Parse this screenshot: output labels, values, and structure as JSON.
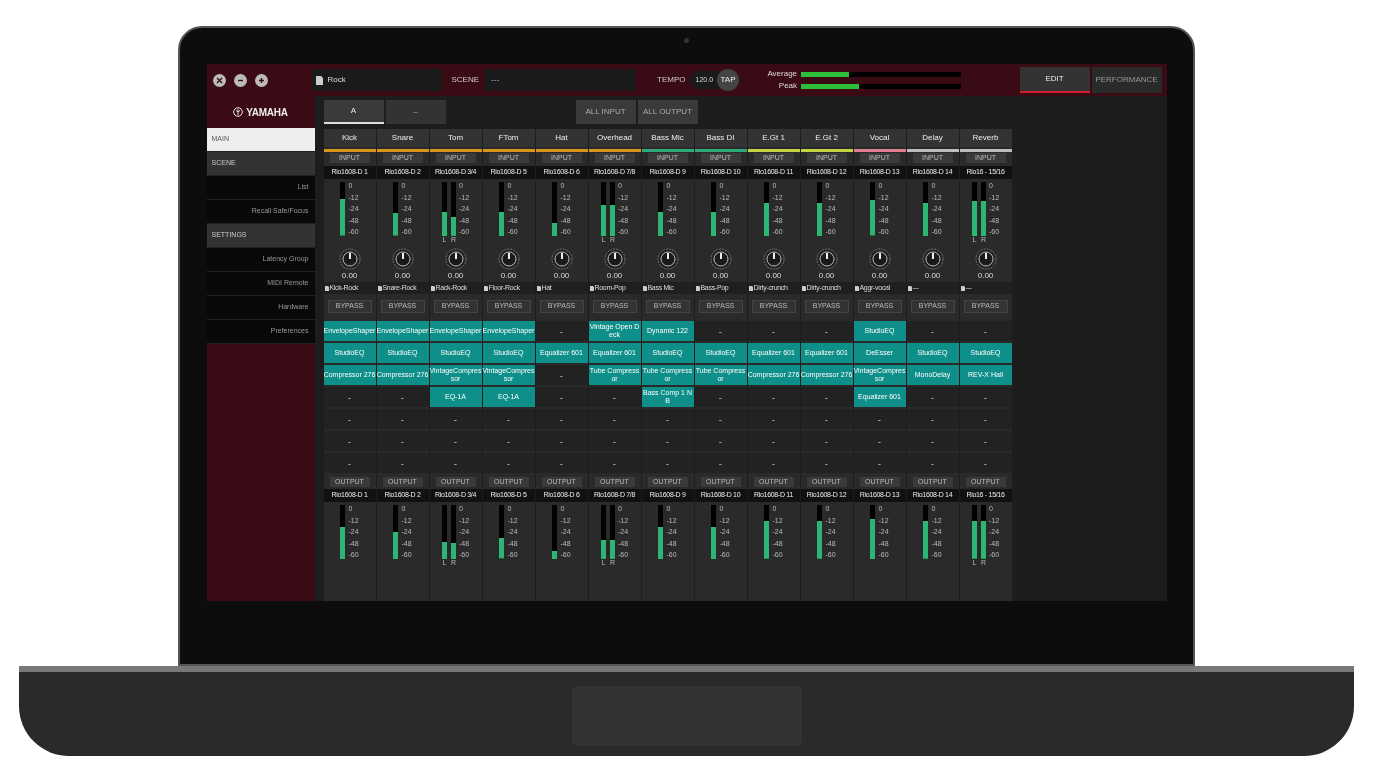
{
  "window": {
    "file_name": "Rock",
    "scene_label": "SCENE",
    "scene_value": "---",
    "tempo_label": "TEMPO",
    "tempo_value": "120.0",
    "tap_label": "TAP",
    "level_meters": [
      {
        "label": "Average",
        "level": 0.3
      },
      {
        "label": "Peak",
        "level": 0.36
      }
    ],
    "mode_tabs": [
      {
        "label": "EDIT",
        "selected": true
      },
      {
        "label": "PERFORMANCE",
        "selected": false
      }
    ]
  },
  "sidebar": {
    "logo": "YAMAHA",
    "items": [
      {
        "kind": "section",
        "label": "MAIN",
        "selected": true
      },
      {
        "kind": "section",
        "label": "SCENE",
        "selected": false
      },
      {
        "kind": "sub",
        "label": "List",
        "selected": false
      },
      {
        "kind": "sub",
        "label": "Recall Safe/Focus",
        "selected": false
      },
      {
        "kind": "section",
        "label": "SETTINGS",
        "selected": false
      },
      {
        "kind": "sub",
        "label": "Latency Group",
        "selected": false
      },
      {
        "kind": "sub",
        "label": "MIDI Remote",
        "selected": false
      },
      {
        "kind": "sub",
        "label": "Hardware",
        "selected": false
      },
      {
        "kind": "sub",
        "label": "Preferences",
        "selected": false
      }
    ]
  },
  "rack_tabs": [
    {
      "label": "A",
      "selected": true
    },
    {
      "label": "–",
      "selected": false
    }
  ],
  "rack_buttons": [
    "ALL INPUT",
    "ALL OUTPUT"
  ],
  "channels": [
    {
      "name": "Kick",
      "color": "#d8971c",
      "input_label": "INPUT",
      "patch": "Rio1608-D 1",
      "meters": [
        {
          "level": 0.68
        }
      ],
      "scale": [
        "0",
        "-12",
        "-24",
        "-48",
        "-60"
      ],
      "knob_value": "0.00",
      "preset": "Kick-Rock",
      "bypass_label": "BYPASS",
      "inserts": [
        {
          "kind": "plugin",
          "name": "EnvelopeShaper"
        },
        {
          "kind": "plugin",
          "name": "StudioEQ"
        },
        {
          "kind": "plugin",
          "name": "Compressor 276"
        },
        {
          "kind": "empty",
          "name": "-"
        },
        {
          "kind": "empty",
          "name": "-"
        },
        {
          "kind": "empty",
          "name": "-"
        },
        {
          "kind": "empty",
          "name": "-"
        }
      ],
      "output_label": "OUTPUT",
      "output_patch": "Rio1608-D 1",
      "output_meters": [
        {
          "level": 0.6
        }
      ],
      "output_scale": [
        "0",
        "-12",
        "-24",
        "-48",
        "-60"
      ]
    },
    {
      "name": "Snare",
      "color": "#d8971c",
      "input_label": "INPUT",
      "patch": "Rio1608-D 2",
      "meters": [
        {
          "level": 0.42
        }
      ],
      "scale": [
        "0",
        "-12",
        "-24",
        "-48",
        "-60"
      ],
      "knob_value": "0.00",
      "preset": "Snare-Rock",
      "bypass_label": "BYPASS",
      "inserts": [
        {
          "kind": "plugin",
          "name": "EnvelopeShaper"
        },
        {
          "kind": "plugin",
          "name": "StudioEQ"
        },
        {
          "kind": "plugin",
          "name": "Compressor 276"
        },
        {
          "kind": "empty",
          "name": "-"
        },
        {
          "kind": "empty",
          "name": "-"
        },
        {
          "kind": "empty",
          "name": "-"
        },
        {
          "kind": "empty",
          "name": "-"
        }
      ],
      "output_label": "OUTPUT",
      "output_patch": "Rio1608-D 2",
      "output_meters": [
        {
          "level": 0.5
        }
      ],
      "output_scale": [
        "0",
        "-12",
        "-24",
        "-48",
        "-60"
      ]
    },
    {
      "name": "Tom",
      "color": "#d8971c",
      "input_label": "INPUT",
      "patch": "Rio1608-D 3/4",
      "meters": [
        {
          "label": "L",
          "level": 0.45
        },
        {
          "label": "R",
          "level": 0.35
        }
      ],
      "scale": [
        "0",
        "-12",
        "-24",
        "-48",
        "-60"
      ],
      "knob_value": "0.00",
      "preset": "Rack-Rock",
      "bypass_label": "BYPASS",
      "inserts": [
        {
          "kind": "plugin",
          "name": "EnvelopeShaper"
        },
        {
          "kind": "plugin",
          "name": "StudioEQ"
        },
        {
          "kind": "plugin",
          "name": "VintageCompressor"
        },
        {
          "kind": "plugin",
          "name": "EQ-1A"
        },
        {
          "kind": "empty",
          "name": "-"
        },
        {
          "kind": "empty",
          "name": "-"
        },
        {
          "kind": "empty",
          "name": "-"
        }
      ],
      "output_label": "OUTPUT",
      "output_patch": "Rio1608-D 3/4",
      "output_meters": [
        {
          "label": "L",
          "level": 0.32
        },
        {
          "label": "R",
          "level": 0.3
        }
      ],
      "output_scale": [
        "0",
        "-12",
        "-24",
        "-48",
        "-60"
      ]
    },
    {
      "name": "FTom",
      "color": "#d8971c",
      "input_label": "INPUT",
      "patch": "Rio1608-D 5",
      "meters": [
        {
          "level": 0.45
        }
      ],
      "scale": [
        "0",
        "-12",
        "-24",
        "-48",
        "-60"
      ],
      "knob_value": "0.00",
      "preset": "Floor-Rock",
      "bypass_label": "BYPASS",
      "inserts": [
        {
          "kind": "plugin",
          "name": "EnvelopeShaper"
        },
        {
          "kind": "plugin",
          "name": "StudioEQ"
        },
        {
          "kind": "plugin",
          "name": "VintageCompressor"
        },
        {
          "kind": "plugin",
          "name": "EQ-1A"
        },
        {
          "kind": "empty",
          "name": "-"
        },
        {
          "kind": "empty",
          "name": "-"
        },
        {
          "kind": "empty",
          "name": "-"
        }
      ],
      "output_label": "OUTPUT",
      "output_patch": "Rio1608-D 5",
      "output_meters": [
        {
          "level": 0.38
        }
      ],
      "output_scale": [
        "0",
        "-12",
        "-24",
        "-48",
        "-60"
      ]
    },
    {
      "name": "Hat",
      "color": "#d8971c",
      "input_label": "INPUT",
      "patch": "Rio1608-D 6",
      "meters": [
        {
          "level": 0.25
        }
      ],
      "scale": [
        "0",
        "-12",
        "-24",
        "-48",
        "-60"
      ],
      "knob_value": "0.00",
      "preset": "Hat",
      "bypass_label": "BYPASS",
      "inserts": [
        {
          "kind": "empty",
          "name": "-"
        },
        {
          "kind": "plugin",
          "name": "Equalizer 601"
        },
        {
          "kind": "empty",
          "name": "-"
        },
        {
          "kind": "empty",
          "name": "-"
        },
        {
          "kind": "empty",
          "name": "-"
        },
        {
          "kind": "empty",
          "name": "-"
        },
        {
          "kind": "empty",
          "name": "-"
        }
      ],
      "output_label": "OUTPUT",
      "output_patch": "Rio1608-D 6",
      "output_meters": [
        {
          "level": 0.15
        }
      ],
      "output_scale": [
        "0",
        "-12",
        "-24",
        "-48",
        "-60"
      ]
    },
    {
      "name": "Overhead",
      "color": "#d8971c",
      "input_label": "INPUT",
      "patch": "Rio1608-D 7/8",
      "meters": [
        {
          "label": "L",
          "level": 0.58
        },
        {
          "label": "R",
          "level": 0.58
        }
      ],
      "scale": [
        "0",
        "-12",
        "-24",
        "-48",
        "-60"
      ],
      "knob_value": "0.00",
      "preset": "Room-Pop",
      "bypass_label": "BYPASS",
      "inserts": [
        {
          "kind": "plugin",
          "name": "Vintage Open Deck"
        },
        {
          "kind": "plugin",
          "name": "Equalizer 601"
        },
        {
          "kind": "plugin",
          "name": "Tube Compressor"
        },
        {
          "kind": "empty",
          "name": "-"
        },
        {
          "kind": "empty",
          "name": "-"
        },
        {
          "kind": "empty",
          "name": "-"
        },
        {
          "kind": "empty",
          "name": "-"
        }
      ],
      "output_label": "OUTPUT",
      "output_patch": "Rio1608-D 7/8",
      "output_meters": [
        {
          "label": "L",
          "level": 0.35
        },
        {
          "label": "R",
          "level": 0.35
        }
      ],
      "output_scale": [
        "0",
        "-12",
        "-24",
        "-48",
        "-60"
      ]
    },
    {
      "name": "Bass Mic",
      "color": "#2fa97a",
      "input_label": "INPUT",
      "patch": "Rio1608-D 9",
      "meters": [
        {
          "level": 0.45
        }
      ],
      "scale": [
        "0",
        "-12",
        "-24",
        "-48",
        "-60"
      ],
      "knob_value": "0.00",
      "preset": "Bass Mic",
      "bypass_label": "BYPASS",
      "inserts": [
        {
          "kind": "plugin",
          "name": "Dynamic 122"
        },
        {
          "kind": "plugin",
          "name": "StudioEQ"
        },
        {
          "kind": "plugin",
          "name": "Tube Compressor"
        },
        {
          "kind": "plugin",
          "name": "Bass Comp 1 NB"
        },
        {
          "kind": "empty",
          "name": "-"
        },
        {
          "kind": "empty",
          "name": "-"
        },
        {
          "kind": "empty",
          "name": "-"
        }
      ],
      "output_label": "OUTPUT",
      "output_patch": "Rio1608-D 9",
      "output_meters": [
        {
          "level": 0.6
        }
      ],
      "output_scale": [
        "0",
        "-12",
        "-24",
        "-48",
        "-60"
      ]
    },
    {
      "name": "Bass DI",
      "color": "#2fa97a",
      "input_label": "INPUT",
      "patch": "Rio1608-D 10",
      "meters": [
        {
          "level": 0.45
        }
      ],
      "scale": [
        "0",
        "-12",
        "-24",
        "-48",
        "-60"
      ],
      "knob_value": "0.00",
      "preset": "Bass-Pop",
      "bypass_label": "BYPASS",
      "inserts": [
        {
          "kind": "empty",
          "name": "-"
        },
        {
          "kind": "plugin",
          "name": "StudioEQ"
        },
        {
          "kind": "plugin",
          "name": "Tube Compressor"
        },
        {
          "kind": "empty",
          "name": "-"
        },
        {
          "kind": "empty",
          "name": "-"
        },
        {
          "kind": "empty",
          "name": "-"
        },
        {
          "kind": "empty",
          "name": "-"
        }
      ],
      "output_label": "OUTPUT",
      "output_patch": "Rio1608-D 10",
      "output_meters": [
        {
          "level": 0.6
        }
      ],
      "output_scale": [
        "0",
        "-12",
        "-24",
        "-48",
        "-60"
      ]
    },
    {
      "name": "E.Gt 1",
      "color": "#c3d443",
      "input_label": "INPUT",
      "patch": "Rio1608-D 11",
      "meters": [
        {
          "level": 0.62
        }
      ],
      "scale": [
        "0",
        "-12",
        "-24",
        "-48",
        "-60"
      ],
      "knob_value": "0.00",
      "preset": "Dirty-crunch",
      "bypass_label": "BYPASS",
      "inserts": [
        {
          "kind": "empty",
          "name": "-"
        },
        {
          "kind": "plugin",
          "name": "Equalizer 601"
        },
        {
          "kind": "plugin",
          "name": "Compressor 276"
        },
        {
          "kind": "empty",
          "name": "-"
        },
        {
          "kind": "empty",
          "name": "-"
        },
        {
          "kind": "empty",
          "name": "-"
        },
        {
          "kind": "empty",
          "name": "-"
        }
      ],
      "output_label": "OUTPUT",
      "output_patch": "Rio1608-D 11",
      "output_meters": [
        {
          "level": 0.7
        }
      ],
      "output_scale": [
        "0",
        "-12",
        "-24",
        "-48",
        "-60"
      ]
    },
    {
      "name": "E.Gt 2",
      "color": "#c3d443",
      "input_label": "INPUT",
      "patch": "Rio1608-D 12",
      "meters": [
        {
          "level": 0.62
        }
      ],
      "scale": [
        "0",
        "-12",
        "-24",
        "-48",
        "-60"
      ],
      "knob_value": "0.00",
      "preset": "Dirty-crunch",
      "bypass_label": "BYPASS",
      "inserts": [
        {
          "kind": "empty",
          "name": "-"
        },
        {
          "kind": "plugin",
          "name": "Equalizer 601"
        },
        {
          "kind": "plugin",
          "name": "Compressor 276"
        },
        {
          "kind": "empty",
          "name": "-"
        },
        {
          "kind": "empty",
          "name": "-"
        },
        {
          "kind": "empty",
          "name": "-"
        },
        {
          "kind": "empty",
          "name": "-"
        }
      ],
      "output_label": "OUTPUT",
      "output_patch": "Rio1608-D 12",
      "output_meters": [
        {
          "level": 0.7
        }
      ],
      "output_scale": [
        "0",
        "-12",
        "-24",
        "-48",
        "-60"
      ]
    },
    {
      "name": "Vocal",
      "color": "#e07d8e",
      "input_label": "INPUT",
      "patch": "Rio1608-D 13",
      "meters": [
        {
          "level": 0.66
        }
      ],
      "scale": [
        "0",
        "-12",
        "-24",
        "-48",
        "-60"
      ],
      "knob_value": "0.00",
      "preset": "Aggr-vocal",
      "bypass_label": "BYPASS",
      "inserts": [
        {
          "kind": "plugin",
          "name": "StudioEQ"
        },
        {
          "kind": "plugin",
          "name": "DeEsser"
        },
        {
          "kind": "plugin",
          "name": "VintageCompressor"
        },
        {
          "kind": "plugin",
          "name": "Equalizer 601"
        },
        {
          "kind": "empty",
          "name": "-"
        },
        {
          "kind": "empty",
          "name": "-"
        },
        {
          "kind": "empty",
          "name": "-"
        }
      ],
      "output_label": "OUTPUT",
      "output_patch": "Rio1608-D 13",
      "output_meters": [
        {
          "level": 0.75
        }
      ],
      "output_scale": [
        "0",
        "-12",
        "-24",
        "-48",
        "-60"
      ]
    },
    {
      "name": "Delay",
      "color": "#bdbdbd",
      "input_label": "INPUT",
      "patch": "Rio1608-D 14",
      "meters": [
        {
          "level": 0.62
        }
      ],
      "scale": [
        "0",
        "-12",
        "-24",
        "-48",
        "-60"
      ],
      "knob_value": "0.00",
      "preset": "---",
      "bypass_label": "BYPASS",
      "inserts": [
        {
          "kind": "empty",
          "name": "-"
        },
        {
          "kind": "plugin",
          "name": "StudioEQ"
        },
        {
          "kind": "plugin",
          "name": "MonoDelay"
        },
        {
          "kind": "empty",
          "name": "-"
        },
        {
          "kind": "empty",
          "name": "-"
        },
        {
          "kind": "empty",
          "name": "-"
        },
        {
          "kind": "empty",
          "name": "-"
        }
      ],
      "output_label": "OUTPUT",
      "output_patch": "Rio1608-D 14",
      "output_meters": [
        {
          "level": 0.7
        }
      ],
      "output_scale": [
        "0",
        "-12",
        "-24",
        "-48",
        "-60"
      ]
    },
    {
      "name": "Reverb",
      "color": "#bdbdbd",
      "input_label": "INPUT",
      "patch": "Rio16 - 15/16",
      "meters": [
        {
          "label": "L",
          "level": 0.65
        },
        {
          "label": "R",
          "level": 0.65
        }
      ],
      "scale": [
        "0",
        "-12",
        "-24",
        "-48",
        "-60"
      ],
      "knob_value": "0.00",
      "preset": "---",
      "bypass_label": "BYPASS",
      "inserts": [
        {
          "kind": "empty",
          "name": "-"
        },
        {
          "kind": "plugin",
          "name": "StudioEQ"
        },
        {
          "kind": "plugin",
          "name": "REV-X Hall"
        },
        {
          "kind": "empty",
          "name": "-"
        },
        {
          "kind": "empty",
          "name": "-"
        },
        {
          "kind": "empty",
          "name": "-"
        },
        {
          "kind": "empty",
          "name": "-"
        }
      ],
      "output_label": "OUTPUT",
      "output_patch": "Rio16 - 15/16",
      "output_meters": [
        {
          "label": "L",
          "level": 0.7
        },
        {
          "label": "R",
          "level": 0.7
        }
      ],
      "output_scale": [
        "0",
        "-12",
        "-24",
        "-48",
        "-60"
      ]
    }
  ]
}
